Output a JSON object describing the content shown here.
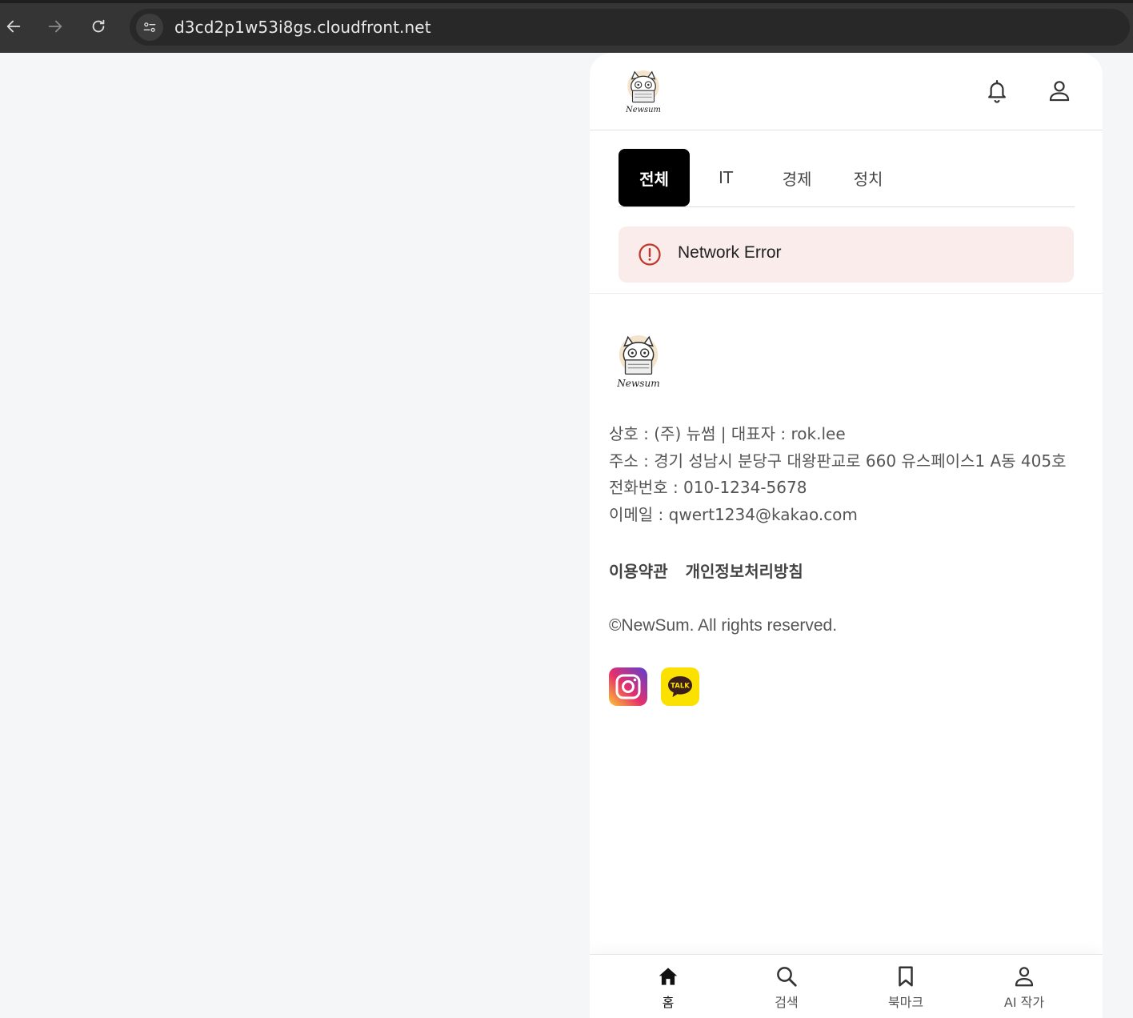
{
  "browser": {
    "url": "d3cd2p1w53i8gs.cloudfront.net"
  },
  "header": {
    "logo_text": "Newsum"
  },
  "tabs": [
    {
      "label": "전체",
      "active": true
    },
    {
      "label": "IT",
      "active": false
    },
    {
      "label": "경제",
      "active": false
    },
    {
      "label": "정치",
      "active": false
    }
  ],
  "error": {
    "message": "Network Error"
  },
  "footer": {
    "logo_text": "Newsum",
    "company_line": "상호 : (주) 뉴썸 | 대표자 : rok.lee",
    "address_line": "주소 : 경기 성남시 분당구 대왕판교로 660 유스페이스1 A동 405호",
    "phone_line": "전화번호 : 010-1234-5678",
    "email_line": "이메일 : qwert1234@kakao.com",
    "terms_link": "이용약관",
    "privacy_link": "개인정보처리방침",
    "copyright": "©NewSum. All rights reserved.",
    "social": [
      {
        "icon": "instagram-icon"
      },
      {
        "icon": "kakaotalk-icon",
        "badge_text": "TALK"
      }
    ]
  },
  "bottom_nav": [
    {
      "label": "홈",
      "icon": "home-icon",
      "active": true
    },
    {
      "label": "검색",
      "icon": "search-icon",
      "active": false
    },
    {
      "label": "북마크",
      "icon": "bookmark-icon",
      "active": false
    },
    {
      "label": "AI 작가",
      "icon": "person-icon",
      "active": false
    }
  ],
  "colors": {
    "active_tab_bg": "#000000",
    "error_bg": "#fbecec",
    "error_icon": "#c0392b",
    "kakao_yellow": "#fae100"
  }
}
